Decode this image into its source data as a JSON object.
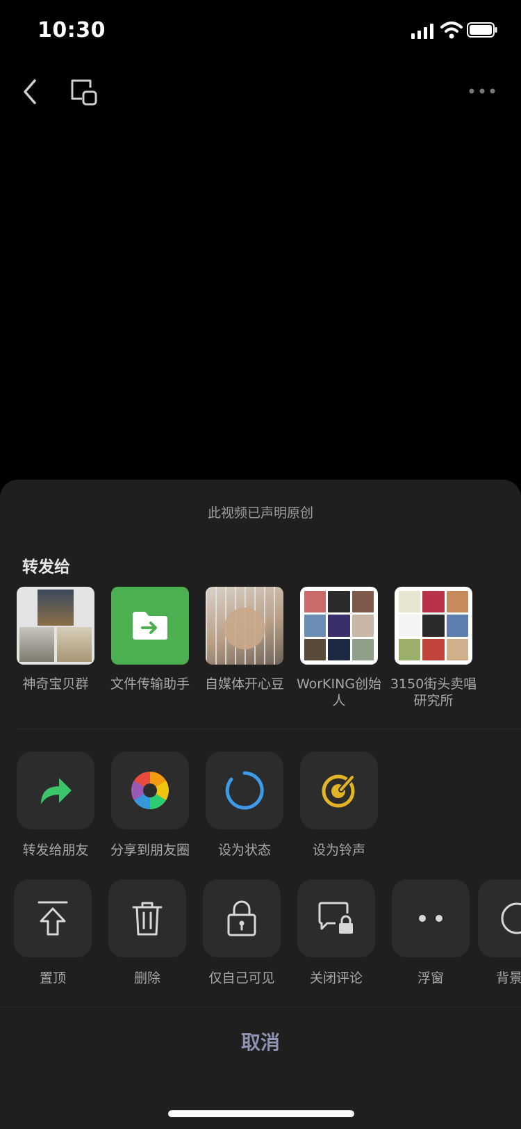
{
  "status": {
    "time": "10:30"
  },
  "sheet": {
    "notice": "此视频已声明原创",
    "share_title": "转发给",
    "contacts": [
      {
        "name": "神奇宝贝群"
      },
      {
        "name": "文件传输助手"
      },
      {
        "name": "自媒体开心豆"
      },
      {
        "name": "WorKING创始人"
      },
      {
        "name": "3150街头卖唱研究所"
      }
    ],
    "actions_row1": [
      {
        "label": "转发给朋友",
        "icon": "forward-arrow-icon"
      },
      {
        "label": "分享到朋友圈",
        "icon": "moments-aperture-icon"
      },
      {
        "label": "设为状态",
        "icon": "status-ring-icon"
      },
      {
        "label": "设为铃声",
        "icon": "ringtone-icon"
      }
    ],
    "actions_row2": [
      {
        "label": "置顶",
        "icon": "pin-top-icon"
      },
      {
        "label": "删除",
        "icon": "trash-icon"
      },
      {
        "label": "仅自己可见",
        "icon": "lock-icon"
      },
      {
        "label": "关闭评论",
        "icon": "comment-lock-icon"
      },
      {
        "label": "浮窗",
        "icon": "floating-window-icon"
      },
      {
        "label": "背景",
        "icon": "background-icon"
      }
    ],
    "cancel": "取消"
  },
  "colors": {
    "sheet_bg": "#1f1f1f",
    "tile_bg": "#2c2c2c",
    "file_transfer_green": "#4caf50",
    "forward_green": "#3cc46a",
    "status_blue": "#3d9be9",
    "ringtone_gold": "#e3b425"
  }
}
